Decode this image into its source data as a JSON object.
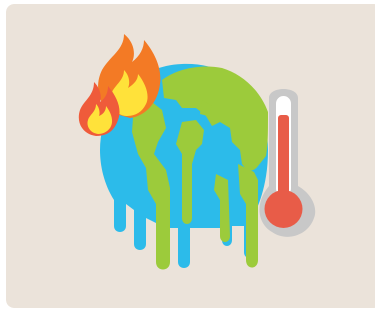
{
  "illustration": {
    "subject": [
      "earth-globe-icon",
      "fire-icon",
      "thermometer-icon"
    ]
  },
  "colors": {
    "card_background": "#ebe3da",
    "ocean": "#2cbbea",
    "land": "#9ccb3b",
    "flame_outer": "#f37a25",
    "flame_inner": "#ffe23a",
    "flame_small_outer": "#ef5b3a",
    "thermometer_frame": "#c8c8c8",
    "thermometer_tube": "#ffffff",
    "mercury": "#e85c48"
  },
  "thermometer": {
    "level": 0.85
  }
}
